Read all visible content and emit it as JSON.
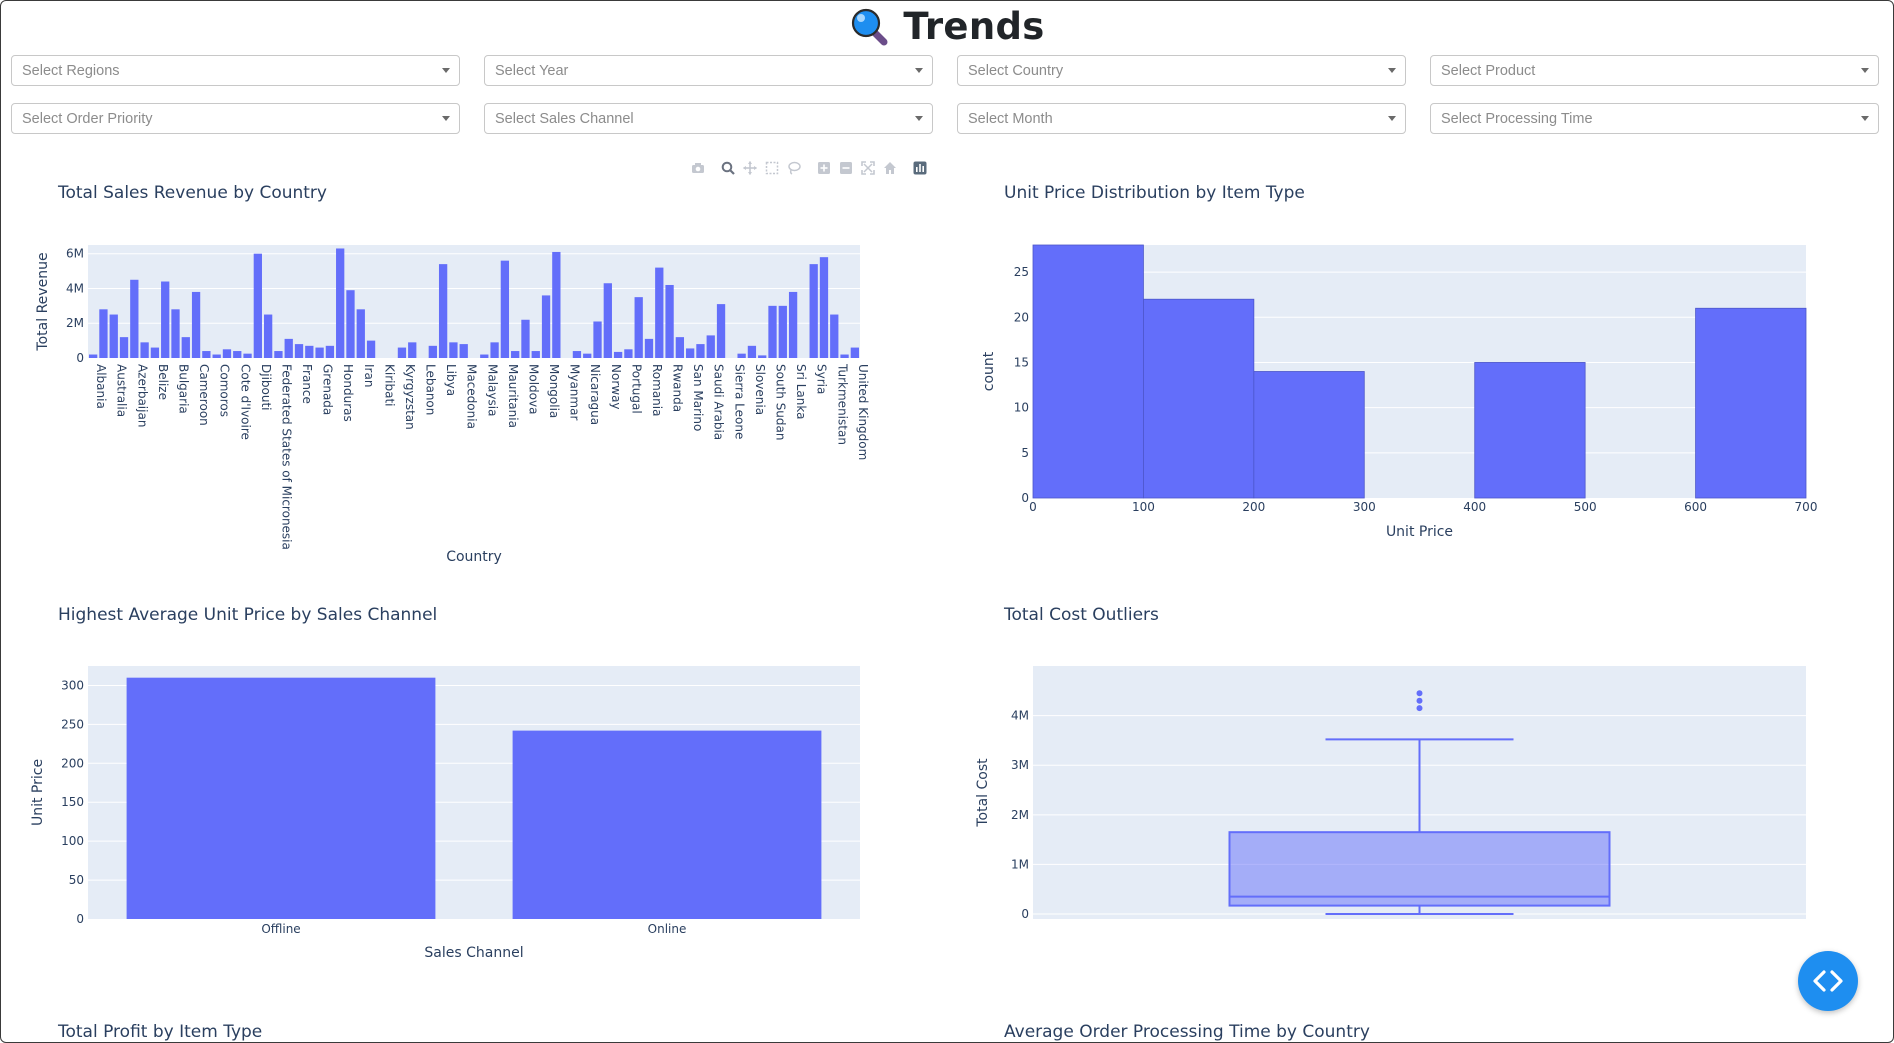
{
  "header": {
    "title": "Trends",
    "icon": "magnifier-icon"
  },
  "filters": [
    {
      "placeholder": "Select Regions"
    },
    {
      "placeholder": "Select Year"
    },
    {
      "placeholder": "Select Country"
    },
    {
      "placeholder": "Select Product"
    },
    {
      "placeholder": "Select Order Priority"
    },
    {
      "placeholder": "Select Sales Channel"
    },
    {
      "placeholder": "Select Month"
    },
    {
      "placeholder": "Select Processing Time"
    }
  ],
  "modebar": [
    "camera-icon",
    "zoom-icon",
    "pan-icon",
    "box-select-icon",
    "lasso-select-icon",
    "zoom-in-icon",
    "zoom-out-icon",
    "autoscale-icon",
    "reset-axes-icon",
    "plotly-logo-icon"
  ],
  "colors": {
    "bar": "#636efa",
    "plot_bg": "#e5ecf6",
    "text": "#2a3f5f",
    "fab": "#1e8ef0"
  },
  "bottom_titles": [
    "Total Profit by Item Type",
    "Average Order Processing Time by Country"
  ],
  "chart_data": [
    {
      "type": "bar",
      "title": "Total Sales Revenue by Country",
      "xlabel": "Country",
      "ylabel": "Total Revenue",
      "ylim": [
        0,
        6500000
      ],
      "yticks": [
        {
          "v": 0,
          "t": "0"
        },
        {
          "v": 2000000,
          "t": "2M"
        },
        {
          "v": 4000000,
          "t": "4M"
        },
        {
          "v": 6000000,
          "t": "6M"
        }
      ],
      "tick_labels": [
        "Albania",
        "Australia",
        "Azerbaijan",
        "Belize",
        "Bulgaria",
        "Cameroon",
        "Comoros",
        "Cote d'Ivoire",
        "Djibouti",
        "Federated States of Micronesia",
        "France",
        "Grenada",
        "Honduras",
        "Iran",
        "Kiribati",
        "Kyrgyzstan",
        "Lebanon",
        "Libya",
        "Macedonia",
        "Malaysia",
        "Mauritania",
        "Moldova",
        "Mongolia",
        "Myanmar",
        "Nicaragua",
        "Norway",
        "Portugal",
        "Romania",
        "Rwanda",
        "San Marino",
        "Saudi Arabia",
        "Sierra Leone",
        "Slovenia",
        "South Sudan",
        "Sri Lanka",
        "Syria",
        "Turkmenistan",
        "United Kingdom"
      ],
      "values": [
        200000,
        2800000,
        2500000,
        1200000,
        4500000,
        900000,
        600000,
        4400000,
        2800000,
        1200000,
        3800000,
        400000,
        200000,
        500000,
        400000,
        250000,
        6000000,
        2500000,
        400000,
        1100000,
        800000,
        700000,
        600000,
        700000,
        6300000,
        3900000,
        2800000,
        1000000,
        0,
        0,
        600000,
        900000,
        0,
        700000,
        5400000,
        900000,
        800000,
        0,
        200000,
        900000,
        5600000,
        400000,
        2200000,
        400000,
        3600000,
        6100000,
        0,
        400000,
        250000,
        2100000,
        4300000,
        350000,
        500000,
        3500000,
        1100000,
        5200000,
        4200000,
        1200000,
        550000,
        800000,
        1300000,
        3100000,
        0,
        250000,
        700000,
        150000,
        3000000,
        3000000,
        3800000,
        0,
        5400000,
        5800000,
        2500000,
        200000,
        600000
      ]
    },
    {
      "type": "bar",
      "title": "Unit Price Distribution by Item Type",
      "xlabel": "Unit Price",
      "ylabel": "count",
      "xlim": [
        0,
        700
      ],
      "ylim": [
        0,
        28
      ],
      "xticks": [
        0,
        100,
        200,
        300,
        400,
        500,
        600,
        700
      ],
      "yticks": [
        0,
        5,
        10,
        15,
        20,
        25
      ],
      "bins": [
        {
          "x0": 0,
          "x1": 100,
          "count": 28
        },
        {
          "x0": 100,
          "x1": 200,
          "count": 22
        },
        {
          "x0": 200,
          "x1": 300,
          "count": 14
        },
        {
          "x0": 400,
          "x1": 500,
          "count": 15
        },
        {
          "x0": 600,
          "x1": 700,
          "count": 21
        }
      ]
    },
    {
      "type": "bar",
      "title": "Highest Average Unit Price by Sales Channel",
      "xlabel": "Sales Channel",
      "ylabel": "Unit Price",
      "ylim": [
        0,
        325
      ],
      "yticks": [
        0,
        50,
        100,
        150,
        200,
        250,
        300
      ],
      "categories": [
        "Offline",
        "Online"
      ],
      "values": [
        310,
        242
      ]
    },
    {
      "type": "box",
      "title": "Total Cost Outliers",
      "ylabel": "Total Cost",
      "ylim": [
        -100000,
        5000000
      ],
      "yticks": [
        {
          "v": 0,
          "t": "0"
        },
        {
          "v": 1000000,
          "t": "1M"
        },
        {
          "v": 2000000,
          "t": "2M"
        },
        {
          "v": 3000000,
          "t": "3M"
        },
        {
          "v": 4000000,
          "t": "4M"
        }
      ],
      "min": 0,
      "q1": 170000,
      "median": 350000,
      "q3": 1650000,
      "max": 3520000,
      "outliers": [
        4150000,
        4300000,
        4450000
      ]
    }
  ]
}
